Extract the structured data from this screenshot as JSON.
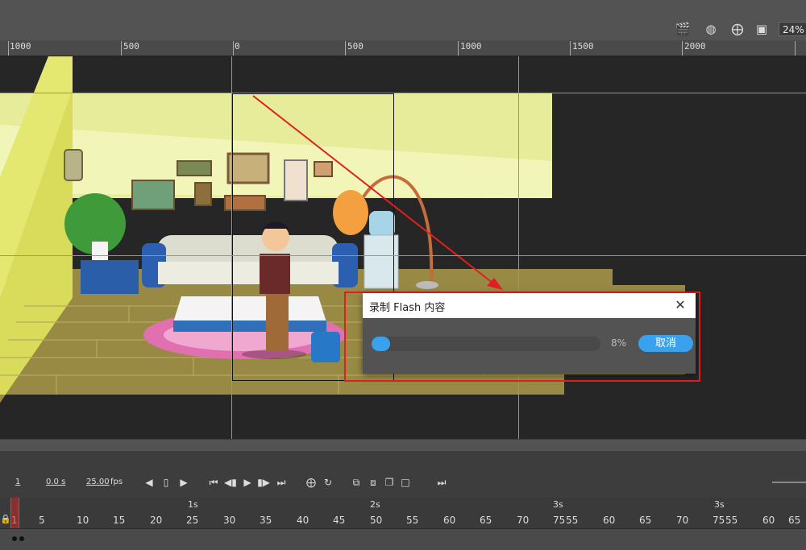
{
  "toolbar": {
    "zoom_value": "24%",
    "icons": [
      "clapperboard-icon",
      "camera-icon",
      "center-stage-icon",
      "clip-icon"
    ]
  },
  "ruler": {
    "labels": [
      "1000",
      "500",
      "0",
      "500",
      "1000",
      "1500",
      "2000"
    ]
  },
  "dialog": {
    "title": "录制 Flash 内容",
    "progress_percent": 8,
    "progress_text": "8%",
    "cancel_label": "取消",
    "close_icon": "close-icon"
  },
  "colors": {
    "guide": "#3fd13f",
    "highlight": "#e02020",
    "accent": "#3aa1ee",
    "arrow": "#e02020"
  },
  "timeline": {
    "frame": "1",
    "time": "0.0 s",
    "fps": "25.00",
    "fps_unit": "fps",
    "seconds_marks": [
      "1s",
      "2s",
      "3s",
      "3s"
    ],
    "frame_numbers": [
      "1",
      "5",
      "10",
      "15",
      "20",
      "25",
      "30",
      "35",
      "40",
      "45",
      "50",
      "55",
      "60",
      "65",
      "70",
      "75",
      "55",
      "60",
      "65",
      "70",
      "75",
      "55",
      "60",
      "65"
    ]
  }
}
